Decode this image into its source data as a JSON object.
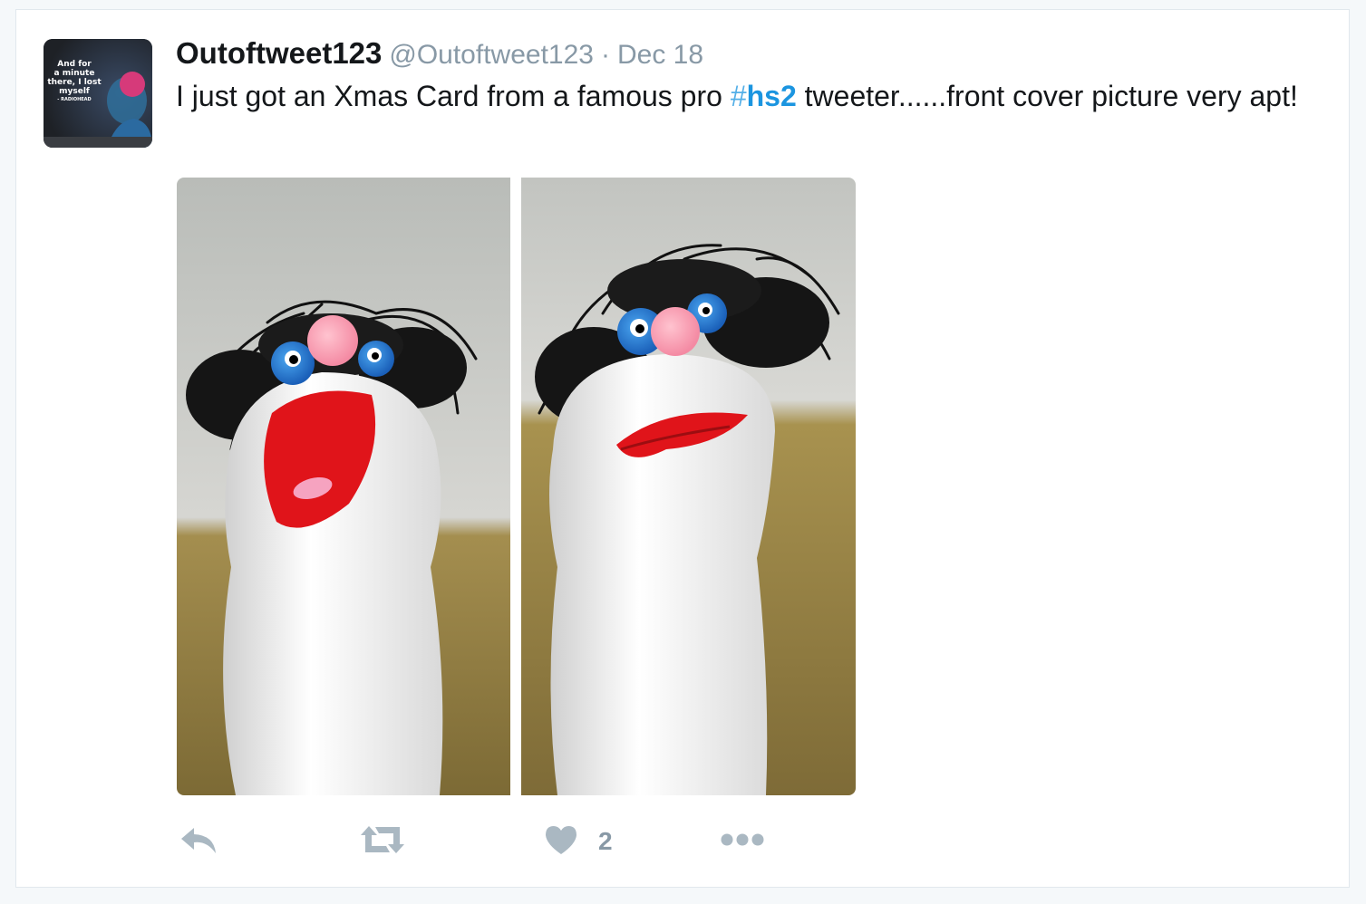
{
  "tweet": {
    "display_name": "Outoftweet123",
    "screen_name": "@Outoftweet123",
    "separator": "·",
    "timestamp": "Dec 18",
    "text_before": "I just got an Xmas Card from a famous pro ",
    "hashtag_symbol": "#",
    "hashtag": "hs2",
    "text_after": " tweeter......front cover picture very apt!",
    "avatar": {
      "line1": "And for",
      "line2": "a minute",
      "line3": "there, I lost",
      "line4": "myself",
      "line5": "- RADIOHEAD"
    },
    "media": {
      "description_icon": "photo-sock-puppets"
    }
  },
  "actions": {
    "reply_icon": "reply-icon",
    "retweet_icon": "retweet-icon",
    "like_icon": "heart-icon",
    "like_count": "2",
    "more_icon": "more-icon"
  },
  "colors": {
    "link": "#1b95e0",
    "muted": "#8899a6",
    "text": "#14171a",
    "background": "#f5f8fa",
    "border": "#e1e8ed"
  }
}
